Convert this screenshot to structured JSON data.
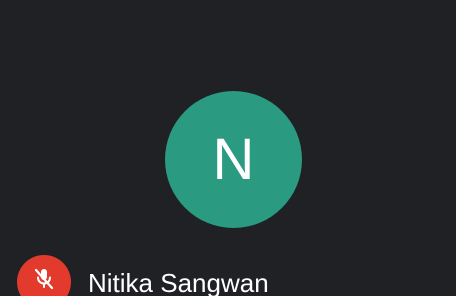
{
  "participant": {
    "initial": "N",
    "name": "Nitika Sangwan",
    "avatar_color": "#2a9a81",
    "mic_status_icon": "mic-off-icon",
    "mic_badge_color": "#e23b2e"
  },
  "theme": {
    "background": "#202124",
    "text_color": "#ffffff"
  }
}
